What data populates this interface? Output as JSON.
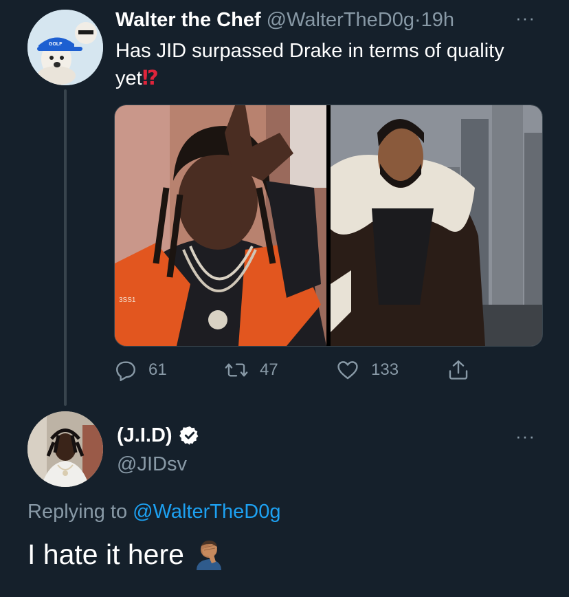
{
  "tweet": {
    "author_name": "Walter the Chef",
    "author_handle": "@WalterTheD0g",
    "separator": "·",
    "time": "19h",
    "more_label": "···",
    "text": "Has JID surpassed Drake in terms of quality yet",
    "text_emoji": "⁉",
    "avatar_cap_text": "GOLF",
    "photo_left_sign": "3SS1",
    "media": [
      {
        "icon": "photo-jid"
      },
      {
        "icon": "photo-drake"
      }
    ],
    "actions": {
      "reply_count": "61",
      "retweet_count": "47",
      "like_count": "133"
    }
  },
  "reply": {
    "author_name": "(J.I.D)",
    "author_handle": "@JIDsv",
    "verified": true,
    "more_label": "···",
    "replying_to_prefix": "Replying to",
    "replying_to_handle": "@WalterTheD0g",
    "text": "I hate it here",
    "emoji": "face-palm-emoji"
  },
  "colors": {
    "background": "#15202b",
    "text_primary": "#ffffff",
    "text_muted": "#8899a6",
    "accent": "#1da1f2",
    "divider": "#38444d"
  }
}
